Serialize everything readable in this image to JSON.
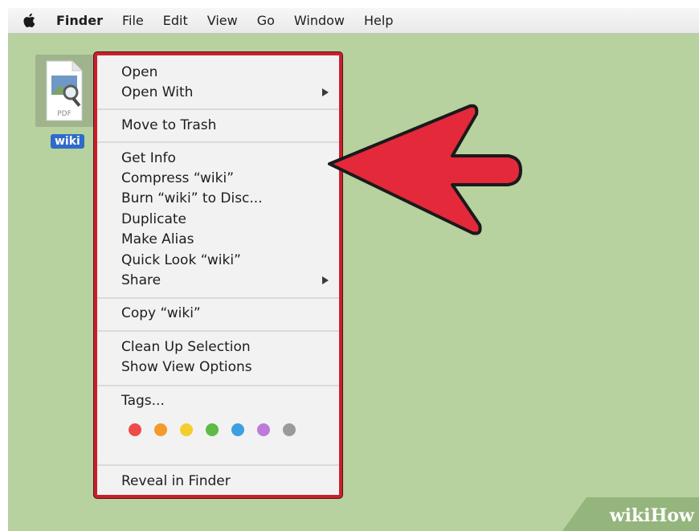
{
  "menubar": {
    "apple": "apple-logo-icon",
    "items": [
      "Finder",
      "File",
      "Edit",
      "View",
      "Go",
      "Window",
      "Help"
    ]
  },
  "file": {
    "name": "wiki",
    "type_label": "PDF"
  },
  "context_menu": {
    "groups": [
      [
        "Open",
        "Open With"
      ],
      [
        "Move to Trash"
      ],
      [
        "Get Info",
        "Compress “wiki”",
        "Burn “wiki” to Disc...",
        "Duplicate",
        "Make Alias",
        "Quick Look “wiki”",
        "Share"
      ],
      [
        "Copy “wiki”"
      ],
      [
        "Clean Up Selection",
        "Show View Options"
      ],
      [
        "Tags..."
      ],
      [
        "Reveal in Finder"
      ]
    ],
    "tag_colors": [
      "#ef4b4b",
      "#f39a2c",
      "#f4cf2c",
      "#5dbb46",
      "#3d9fe3",
      "#bd7ad8",
      "#9a9a9a"
    ]
  },
  "watermark": {
    "text": "wikiHow"
  },
  "colors": {
    "desktop": "#b7d19f",
    "highlight_border": "#c8202d",
    "arrow": "#e4293a"
  }
}
